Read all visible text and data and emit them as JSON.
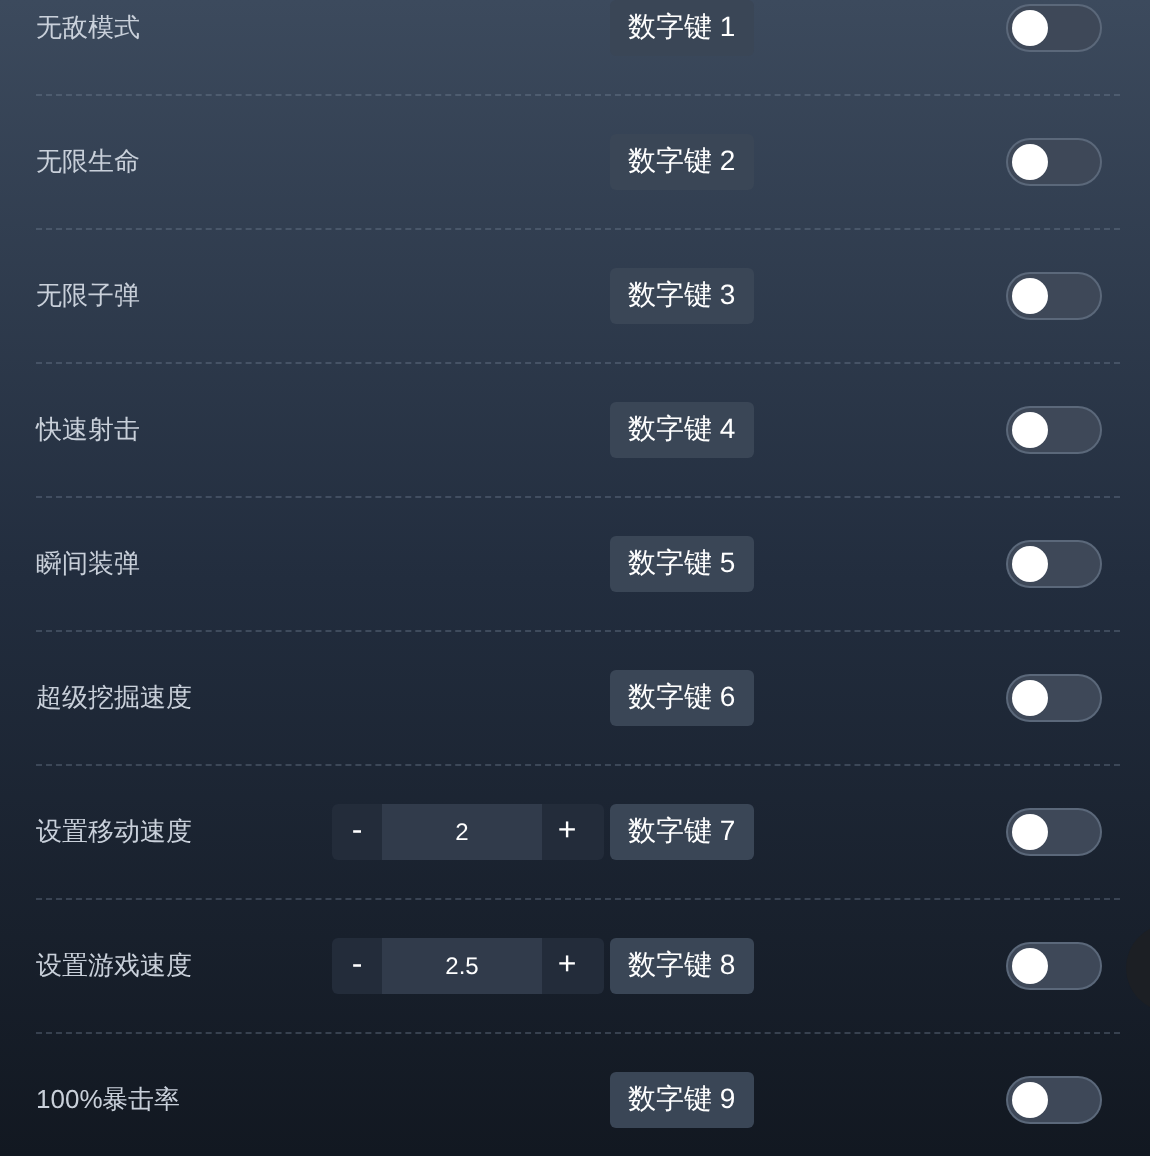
{
  "cheats": [
    {
      "label": "无敌模式",
      "key": "数字键 1",
      "on": false
    },
    {
      "label": "无限生命",
      "key": "数字键 2",
      "on": false
    },
    {
      "label": "无限子弹",
      "key": "数字键 3",
      "on": false
    },
    {
      "label": "快速射击",
      "key": "数字键 4",
      "on": false
    },
    {
      "label": "瞬间装弹",
      "key": "数字键 5",
      "on": false
    },
    {
      "label": "超级挖掘速度",
      "key": "数字键 6",
      "on": false
    },
    {
      "label": "设置移动速度",
      "key": "数字键 7",
      "on": false,
      "stepper": {
        "minus": "-",
        "value": "2",
        "plus": "+"
      }
    },
    {
      "label": "设置游戏速度",
      "key": "数字键 8",
      "on": false,
      "stepper": {
        "minus": "-",
        "value": "2.5",
        "plus": "+"
      }
    },
    {
      "label": "100%暴击率",
      "key": "数字键 9",
      "on": false
    }
  ]
}
